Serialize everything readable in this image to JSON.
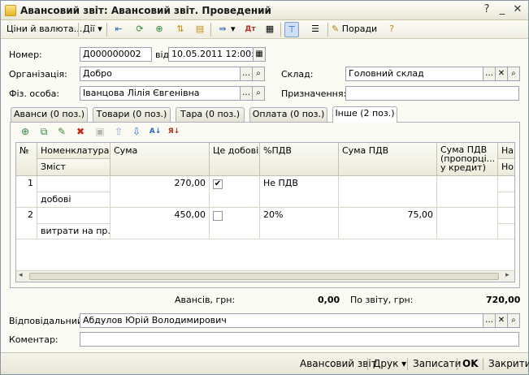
{
  "window": {
    "title": "Авансовий звіт: Авансовий звіт. Проведений",
    "icon": "document-icon"
  },
  "toolbar": {
    "prices_label": "Ціни й валюта...",
    "actions_label": "Дії",
    "tips_label": "Поради"
  },
  "form": {
    "number_label": "Номер:",
    "number_value": "Д000000002",
    "date_label": "від:",
    "date_value": "10.05.2011 12:00:00",
    "organization_label": "Організація:",
    "organization_value": "Добро",
    "warehouse_label": "Склад:",
    "warehouse_value": "Головний склад",
    "person_label": "Фіз. особа:",
    "person_value": "Іванцова Лілія Євгенівна",
    "purpose_label": "Призначення:",
    "purpose_value": ""
  },
  "tabs": [
    {
      "label": "Аванси (0 поз.)"
    },
    {
      "label": "Товари (0 поз.)"
    },
    {
      "label": "Тара (0 поз.)"
    },
    {
      "label": "Оплата (0 поз.)"
    },
    {
      "label": "Інше (2 поз.)"
    }
  ],
  "grid": {
    "headers": {
      "num": "№",
      "nomenclature": "Номенклатура",
      "content": "Зміст",
      "sum": "Сума",
      "is_expense": "Це добові",
      "vat_rate": "%ПДВ",
      "vat_sum": "Сума ПДВ",
      "vat_prop": "Сума ПДВ (пропорці... у кредит)",
      "extra1": "На",
      "extra2": "Но"
    },
    "rows": [
      {
        "num": "1",
        "nomenclature": "",
        "content": "добові",
        "sum": "270,00",
        "is_expense": "✔",
        "vat_rate": "Не ПДВ",
        "vat_sum": ""
      },
      {
        "num": "2",
        "nomenclature": "",
        "content": "витрати на пр...",
        "sum": "450,00",
        "is_expense": "",
        "vat_rate": "20%",
        "vat_sum": "75,00"
      }
    ]
  },
  "totals": {
    "advances_label": "Авансів, грн:",
    "advances_value": "0,00",
    "report_label": "По звіту, грн:",
    "report_value": "720,00"
  },
  "footer_form": {
    "responsible_label": "Відповідальний:",
    "responsible_value": "Абдулов Юрій Володимирович",
    "comment_label": "Коментар:",
    "comment_value": ""
  },
  "bottom": {
    "report_btn": "Авансовий звіт",
    "print_btn": "Друк",
    "save_btn": "Записати",
    "ok_btn": "OK",
    "close_btn": "Закрити"
  }
}
